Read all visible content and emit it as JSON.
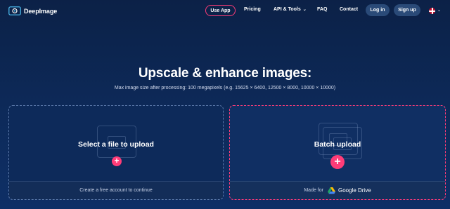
{
  "nav": {
    "logo_text": "DeepImage",
    "use_app": "Use App",
    "pricing": "Pricing",
    "api_tools": "API & Tools",
    "faq": "FAQ",
    "contact": "Contact",
    "login": "Log in",
    "signup": "Sign up",
    "language_icon": "uk-flag-icon"
  },
  "hero": {
    "title": "Upscale & enhance images:",
    "subtitle": "Max image size after processing: 100 megapixels (e.g. 15625 × 6400, 12500 × 8000, 10000 × 10000)"
  },
  "upload_single": {
    "title": "Select a file to upload",
    "footer": "Create a free account to continue"
  },
  "upload_batch": {
    "title": "Batch upload",
    "footer_prefix": "Made for",
    "drive_label": "Google Drive"
  },
  "colors": {
    "background": "#0d2a5a",
    "accent": "#ff3c78",
    "pill": "#2a4a78"
  }
}
